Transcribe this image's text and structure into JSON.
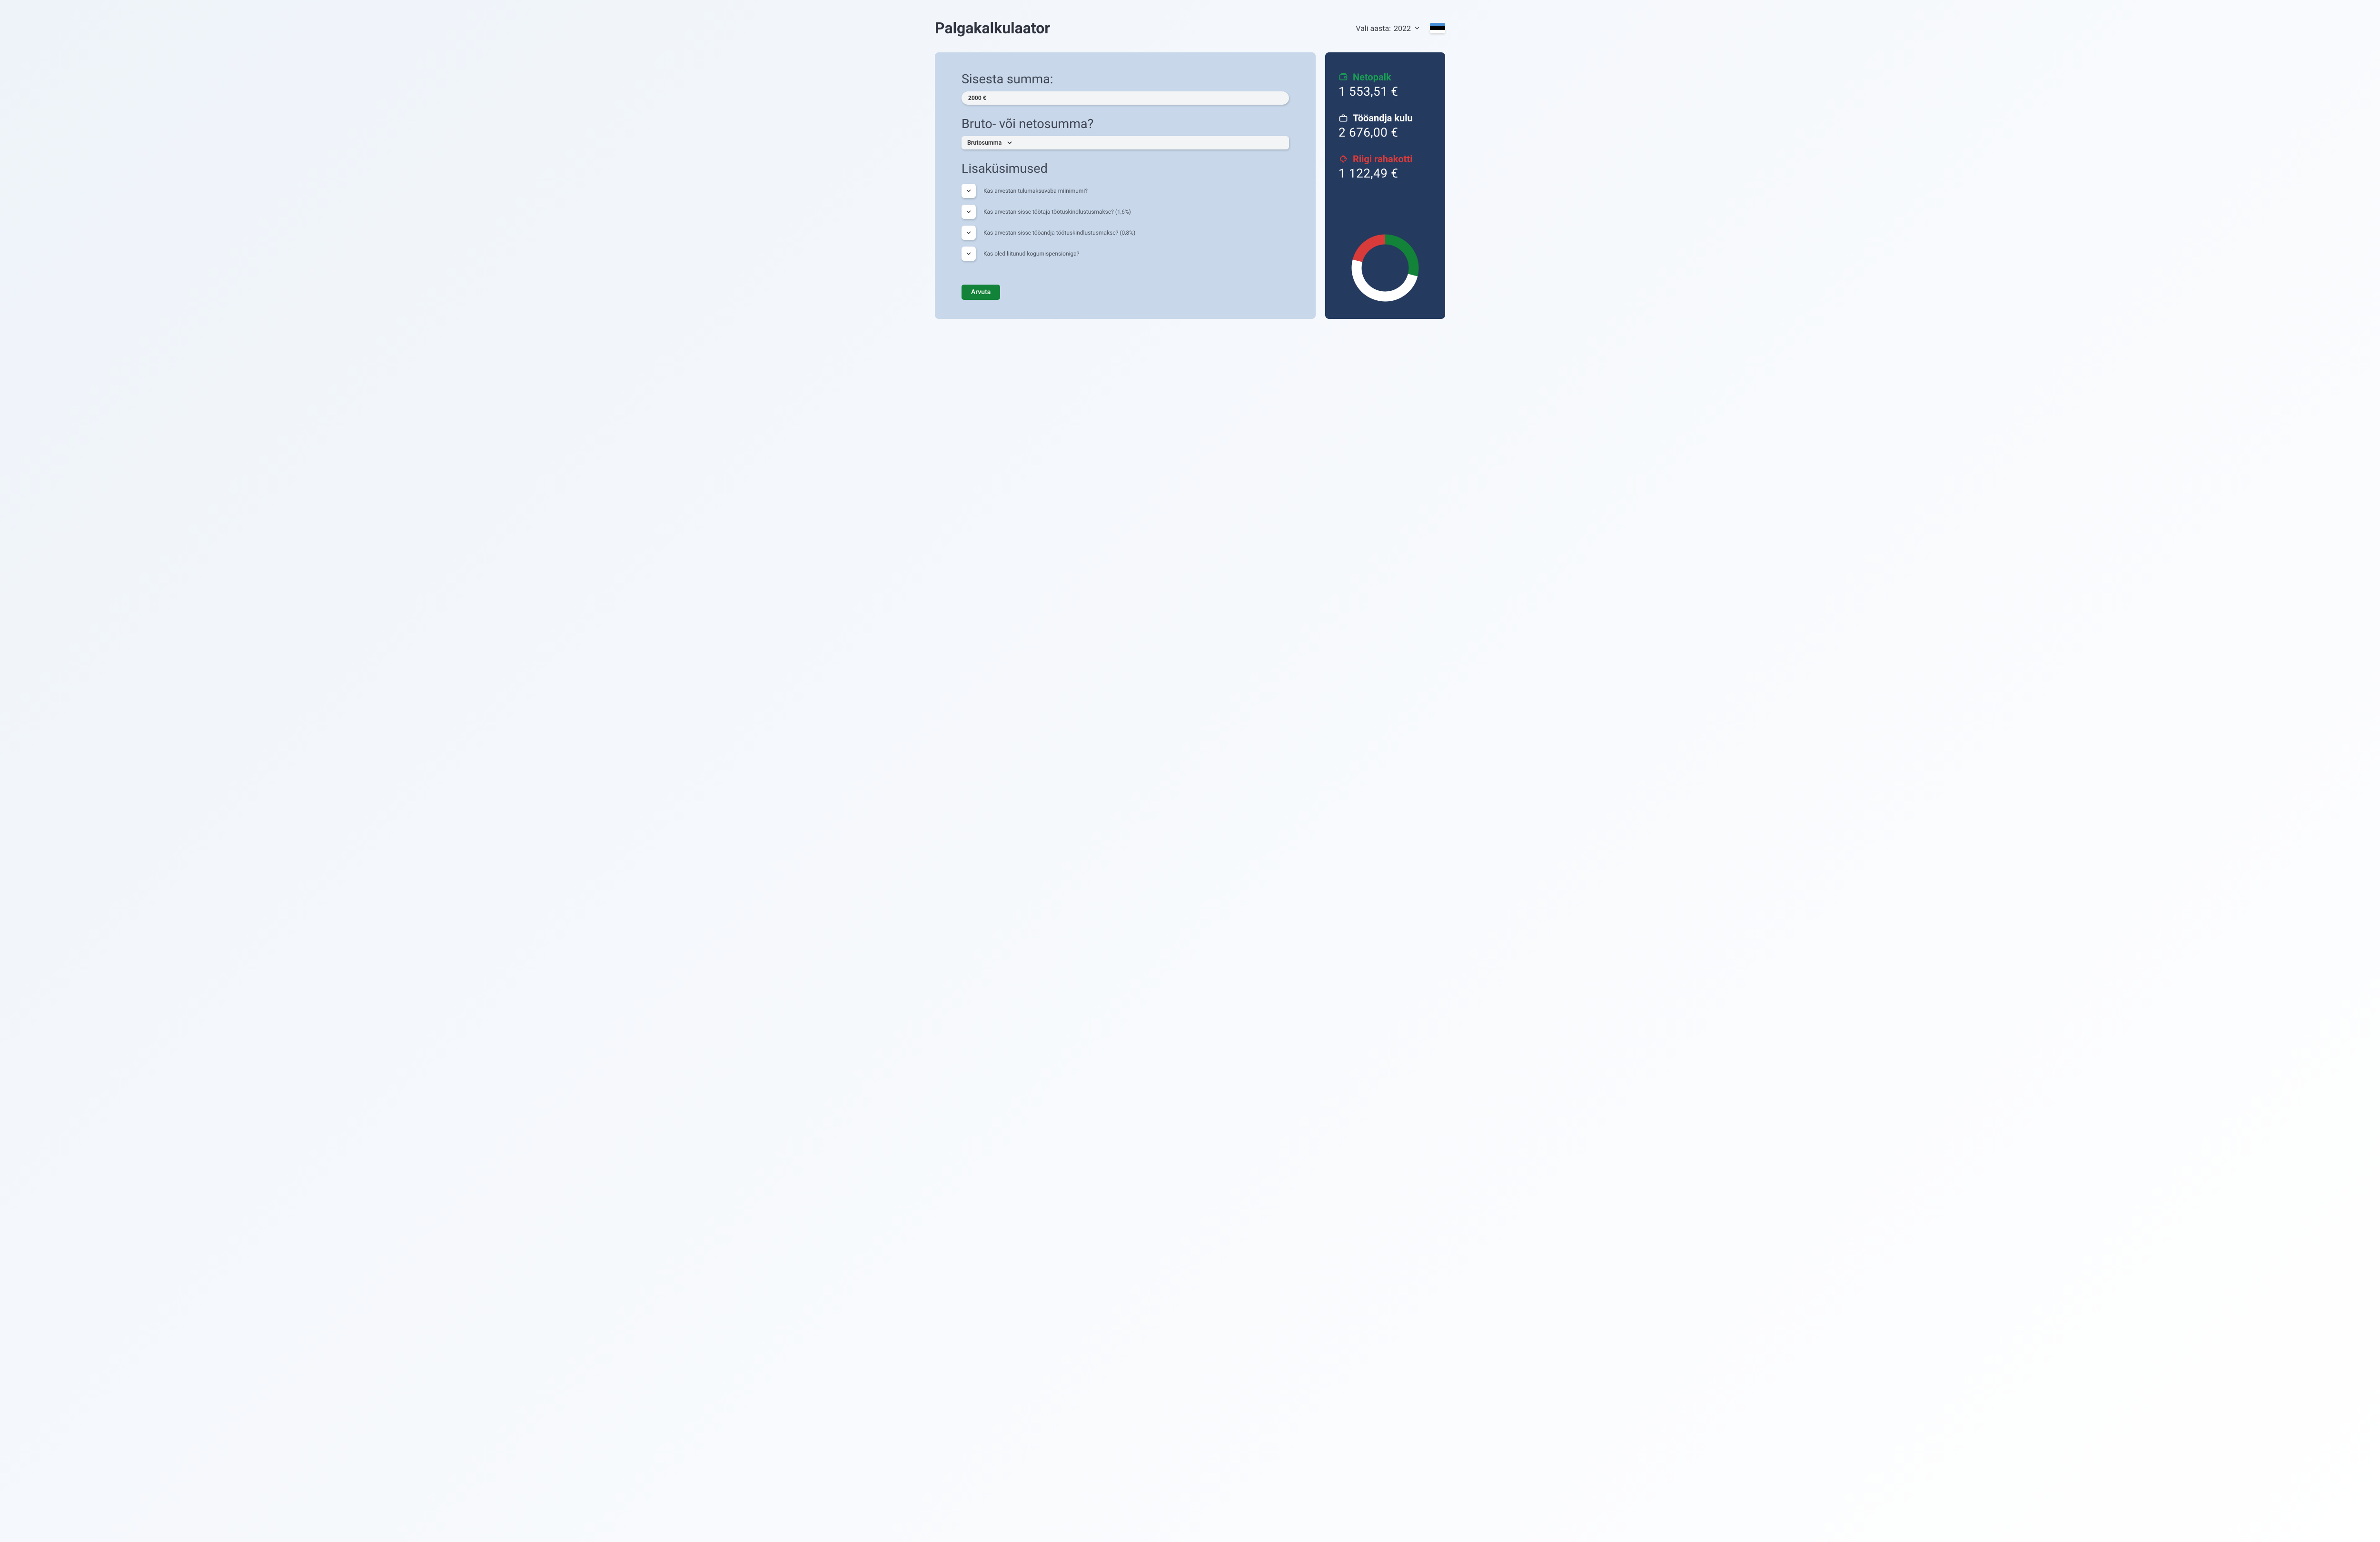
{
  "title": "Palgakalkulaator",
  "yearSelector": {
    "label": "Vali aasta:",
    "value": "2022"
  },
  "input": {
    "sumHeading": "Sisesta summa:",
    "sumValue": "2000 €",
    "typeHeading": "Bruto- või netosumma?",
    "typeValue": "Brutosumma",
    "extrasHeading": "Lisaküsimused",
    "questions": [
      "Kas arvestan tulumaksuvaba miinimumi?",
      "Kas arvestan sisse töötaja töötuskindlustusmakse? (1,6%)",
      "Kas arvestan sisse tööandja töötuskindlustusmakse? (0,8%)",
      "Kas oled liitunud kogumispensioniga?"
    ],
    "button": "Arvuta"
  },
  "results": {
    "net": {
      "label": "Netopalk",
      "value": "1 553,51 €"
    },
    "cost": {
      "label": "Tööandja kulu",
      "value": "2 676,00 €"
    },
    "state": {
      "label": "Riigi rahakotti",
      "value": "1 122,49 €"
    }
  },
  "chart_data": {
    "type": "pie",
    "title": "",
    "series": [
      {
        "name": "Netopalk",
        "value": 1553.51,
        "color": "#128338"
      },
      {
        "name": "Tööandja kulu",
        "value": 2676.0,
        "color": "#ffffff"
      },
      {
        "name": "Riigi rahakotti",
        "value": 1122.49,
        "color": "#d93b3b"
      }
    ]
  }
}
